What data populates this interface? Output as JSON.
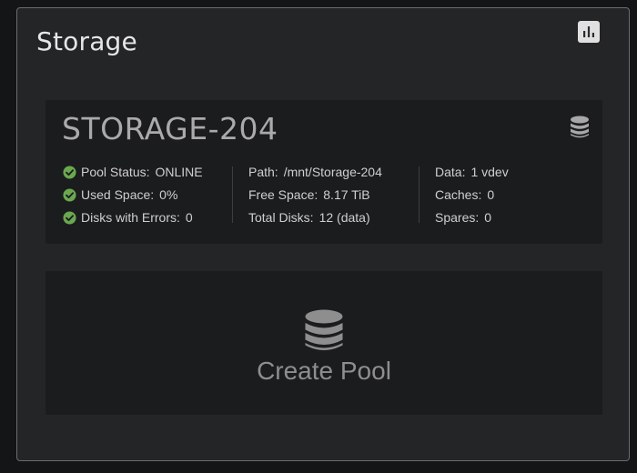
{
  "card": {
    "title": "Storage",
    "chart_button_icon": "bar-chart-icon"
  },
  "pool": {
    "name": "STORAGE-204",
    "icon": "database-icon",
    "status_color": "#6aa84f",
    "col1": [
      {
        "label": "Pool Status:",
        "value": "ONLINE",
        "icon": "check-circle-icon"
      },
      {
        "label": "Used Space:",
        "value": "0%",
        "icon": "check-circle-icon"
      },
      {
        "label": "Disks with Errors:",
        "value": "0",
        "icon": "check-circle-icon"
      }
    ],
    "col2": [
      {
        "label": "Path:",
        "value": "/mnt/Storage-204"
      },
      {
        "label": "Free Space:",
        "value": "8.17 TiB"
      },
      {
        "label": "Total Disks:",
        "value": "12 (data)"
      }
    ],
    "col3": [
      {
        "label": "Data:",
        "value": "1 vdev"
      },
      {
        "label": "Caches:",
        "value": "0"
      },
      {
        "label": "Spares:",
        "value": "0"
      }
    ]
  },
  "create_pool": {
    "label": "Create Pool",
    "icon": "database-icon"
  }
}
